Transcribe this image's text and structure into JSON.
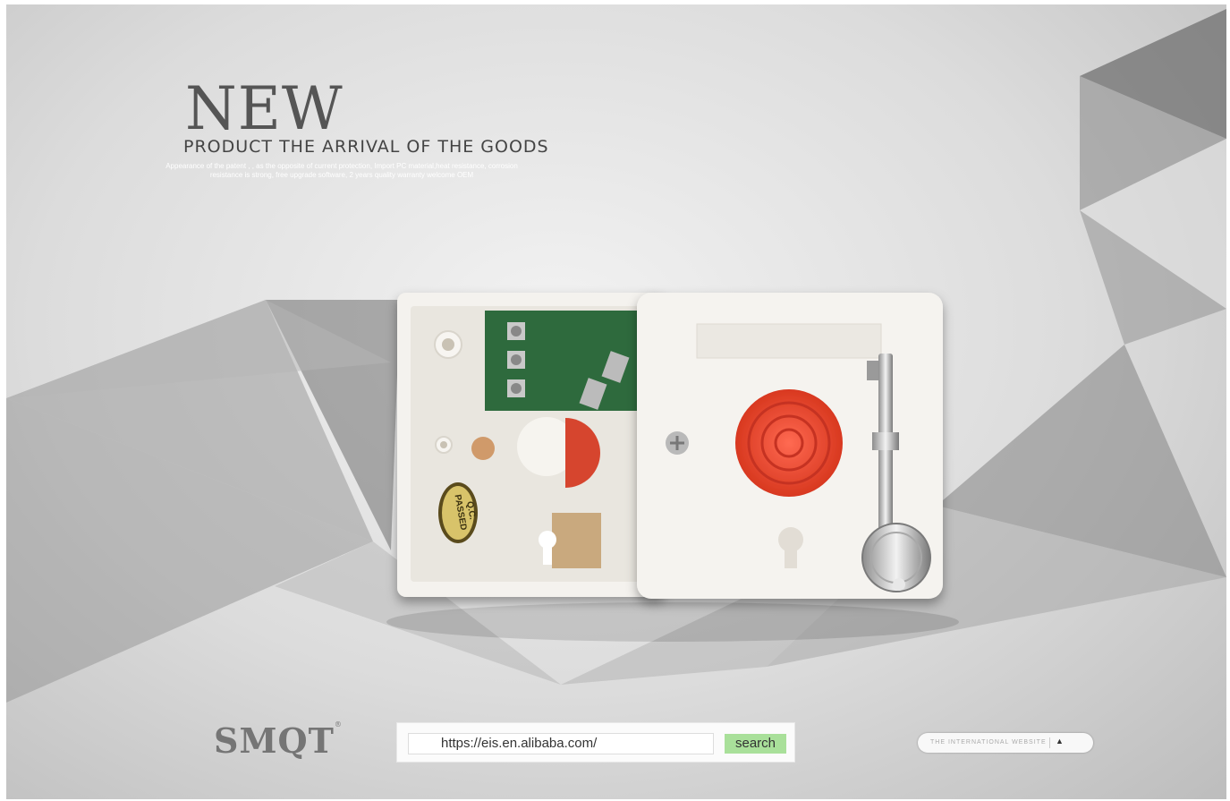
{
  "banner": {
    "headline": "NEW",
    "subheadline": "PRODUCT THE ARRIVAL OF THE GOODS",
    "description": "Appearance of the patent , , as the opposite of current protection, Import PC material,heat resistance, corrosion resistance is strong, free upgrade software, 2 years quality warranty welcome OEM"
  },
  "product": {
    "label_oval": [
      "Q.C.",
      "PASSED"
    ]
  },
  "footer": {
    "logo": "SMQT",
    "logo_mark": "®",
    "search_value": "https://eis.en.alibaba.com/",
    "search_button": "search",
    "international_label": "THE INTERNATIONAL WEBSITE",
    "international_caret": "▲"
  },
  "colors": {
    "button_red": "#e8452e",
    "search_green": "#a9e09a",
    "pcb_green": "#2f6b3c"
  }
}
